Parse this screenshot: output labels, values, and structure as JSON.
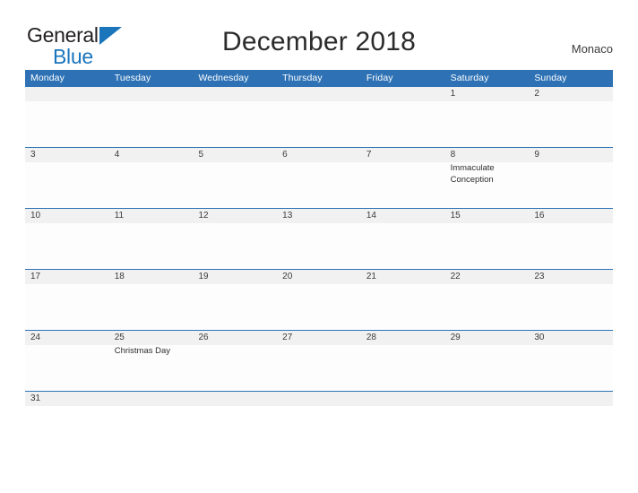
{
  "brand": {
    "word1": "General",
    "word2": "Blue",
    "flag_icon": "blue-triangle-flag-icon",
    "colors": {
      "dark": "#231f20",
      "blue": "#1b75bb"
    }
  },
  "header": {
    "title": "December 2018",
    "region": "Monaco"
  },
  "colors": {
    "header_blue": "#2e72b5",
    "row_separator_blue": "#2e72b5",
    "date_band_gray": "#f1f1f1",
    "cell_white": "#fdfdfd",
    "text_dark": "#2b2b2b"
  },
  "calendar": {
    "month": "December",
    "year": "2018",
    "weekday_headers": [
      "Monday",
      "Tuesday",
      "Wednesday",
      "Thursday",
      "Friday",
      "Saturday",
      "Sunday"
    ],
    "weeks": [
      {
        "days": [
          {
            "date": "",
            "event": ""
          },
          {
            "date": "",
            "event": ""
          },
          {
            "date": "",
            "event": ""
          },
          {
            "date": "",
            "event": ""
          },
          {
            "date": "",
            "event": ""
          },
          {
            "date": "1",
            "event": ""
          },
          {
            "date": "2",
            "event": ""
          }
        ]
      },
      {
        "days": [
          {
            "date": "3",
            "event": ""
          },
          {
            "date": "4",
            "event": ""
          },
          {
            "date": "5",
            "event": ""
          },
          {
            "date": "6",
            "event": ""
          },
          {
            "date": "7",
            "event": ""
          },
          {
            "date": "8",
            "event": "Immaculate Conception"
          },
          {
            "date": "9",
            "event": ""
          }
        ]
      },
      {
        "days": [
          {
            "date": "10",
            "event": ""
          },
          {
            "date": "11",
            "event": ""
          },
          {
            "date": "12",
            "event": ""
          },
          {
            "date": "13",
            "event": ""
          },
          {
            "date": "14",
            "event": ""
          },
          {
            "date": "15",
            "event": ""
          },
          {
            "date": "16",
            "event": ""
          }
        ]
      },
      {
        "days": [
          {
            "date": "17",
            "event": ""
          },
          {
            "date": "18",
            "event": ""
          },
          {
            "date": "19",
            "event": ""
          },
          {
            "date": "20",
            "event": ""
          },
          {
            "date": "21",
            "event": ""
          },
          {
            "date": "22",
            "event": ""
          },
          {
            "date": "23",
            "event": ""
          }
        ]
      },
      {
        "days": [
          {
            "date": "24",
            "event": ""
          },
          {
            "date": "25",
            "event": "Christmas Day"
          },
          {
            "date": "26",
            "event": ""
          },
          {
            "date": "27",
            "event": ""
          },
          {
            "date": "28",
            "event": ""
          },
          {
            "date": "29",
            "event": ""
          },
          {
            "date": "30",
            "event": ""
          }
        ]
      },
      {
        "last": true,
        "days": [
          {
            "date": "31",
            "event": ""
          },
          {
            "date": "",
            "event": ""
          },
          {
            "date": "",
            "event": ""
          },
          {
            "date": "",
            "event": ""
          },
          {
            "date": "",
            "event": ""
          },
          {
            "date": "",
            "event": ""
          },
          {
            "date": "",
            "event": ""
          }
        ]
      }
    ]
  }
}
